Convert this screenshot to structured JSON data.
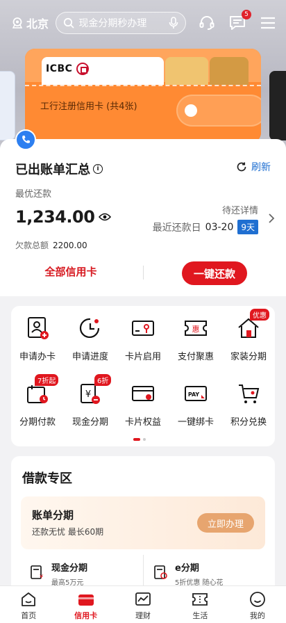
{
  "header": {
    "city": "北京",
    "search_placeholder": "现金分期秒办理",
    "message_badge": "5"
  },
  "wallet": {
    "card_brand": "ICBC",
    "pocket_label": "工行注册信用卡 (共4张)"
  },
  "summary": {
    "title": "已出账单汇总",
    "refresh_label": "刷新",
    "min_payment_label": "最优还款",
    "min_payment_amount": "1,234.00",
    "total_owed_label": "欠款总额",
    "total_owed_value": "2200.00",
    "pending_details_label": "待还详情",
    "due_date_label": "最近还款日",
    "due_date_value": "03-20",
    "days_left": "9天",
    "all_cards_label": "全部信用卡",
    "repay_button_label": "一键还款"
  },
  "services": [
    {
      "label": "申请办卡",
      "icon": "apply-card-icon"
    },
    {
      "label": "申请进度",
      "icon": "progress-clock-icon"
    },
    {
      "label": "卡片启用",
      "icon": "card-activate-icon"
    },
    {
      "label": "支付聚惠",
      "icon": "payment-offers-icon"
    },
    {
      "label": "家装分期",
      "icon": "home-installment-icon",
      "tag": "优惠"
    },
    {
      "label": "分期付款",
      "icon": "installment-pay-icon",
      "tag": "7折起"
    },
    {
      "label": "现金分期",
      "icon": "cash-installment-icon",
      "tag": "6折"
    },
    {
      "label": "卡片权益",
      "icon": "card-benefits-icon"
    },
    {
      "label": "一键绑卡",
      "icon": "bind-card-icon"
    },
    {
      "label": "积分兑换",
      "icon": "points-exchange-icon"
    }
  ],
  "loan": {
    "title": "借款专区",
    "banner_title": "账单分期",
    "banner_sub": "还款无忧 最长60期",
    "banner_button": "立即办理",
    "items": [
      {
        "title": "现金分期",
        "sub": "最高5万元"
      },
      {
        "title": "e分期",
        "sub": "5折优惠 随心花"
      }
    ]
  },
  "tabbar": [
    {
      "label": "首页",
      "icon": "home-icon"
    },
    {
      "label": "信用卡",
      "icon": "credit-card-icon",
      "active": true
    },
    {
      "label": "理财",
      "icon": "wealth-chart-icon"
    },
    {
      "label": "生活",
      "icon": "life-ticket-icon"
    },
    {
      "label": "我的",
      "icon": "profile-face-icon"
    }
  ]
}
